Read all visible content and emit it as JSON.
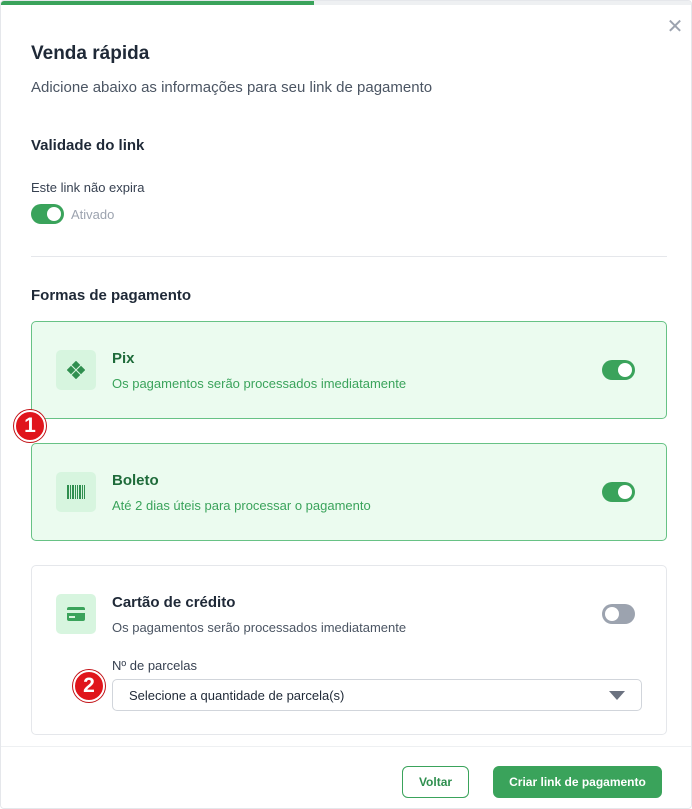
{
  "modal": {
    "title": "Venda rápida",
    "subtitle": "Adicione abaixo as informações para seu link de pagamento",
    "close_glyph": "✕"
  },
  "validity": {
    "section_title": "Validade do link",
    "expire_label": "Este link não expira",
    "toggle_status": "Ativado",
    "toggle_on": true
  },
  "payment": {
    "section_title": "Formas de pagamento",
    "methods": [
      {
        "name": "Pix",
        "description": "Os pagamentos serão processados imediatamente",
        "icon": "pix-icon",
        "enabled": true
      },
      {
        "name": "Boleto",
        "description": "Até 2 dias úteis para processar o pagamento",
        "icon": "barcode-icon",
        "enabled": true
      },
      {
        "name": "Cartão de crédito",
        "description": "Os pagamentos serão processados imediatamente",
        "icon": "credit-card-icon",
        "enabled": false
      }
    ],
    "installments": {
      "label": "Nº de parcelas",
      "placeholder": "Selecione a quantidade de parcela(s)"
    }
  },
  "annotations": {
    "badge_1": "1",
    "badge_2": "2"
  },
  "footer": {
    "back_label": "Voltar",
    "create_label": "Criar link de pagamento"
  },
  "colors": {
    "accent": "#3aa35b",
    "card_on_bg": "#ebfbef",
    "badge": "#e0151b"
  }
}
